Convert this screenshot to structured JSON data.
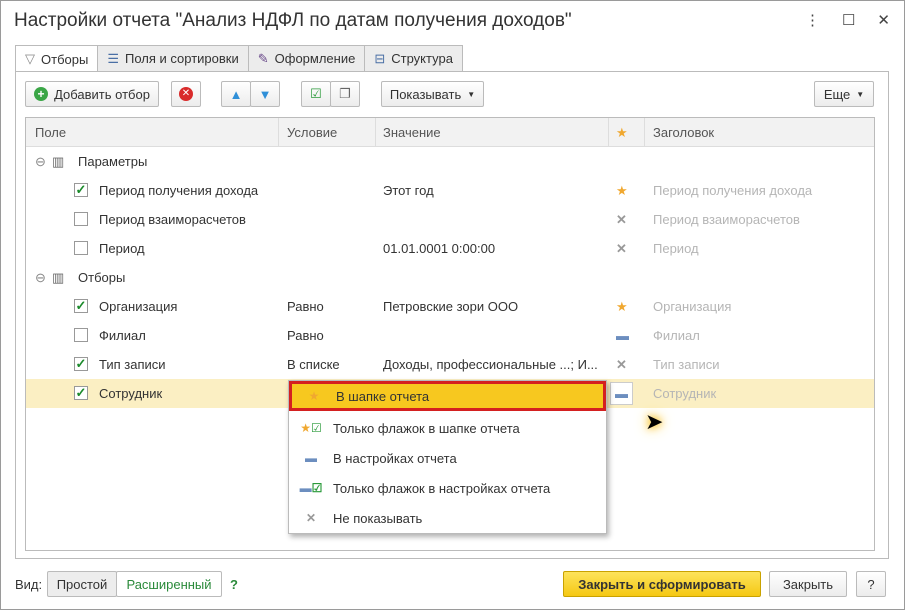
{
  "title": "Настройки отчета \"Анализ НДФЛ по датам получения доходов\"",
  "window_buttons": [
    "⋮",
    "☐",
    "✕"
  ],
  "tabs": [
    {
      "label": "Отборы",
      "icon": "filter-icon"
    },
    {
      "label": "Поля и сортировки",
      "icon": "fields-icon"
    },
    {
      "label": "Оформление",
      "icon": "brush-icon"
    },
    {
      "label": "Структура",
      "icon": "structure-icon"
    }
  ],
  "toolbar": {
    "add": "Добавить отбор",
    "show": "Показывать",
    "more": "Еще"
  },
  "columns": {
    "field": "Поле",
    "condition": "Условие",
    "value": "Значение",
    "title": "Заголовок"
  },
  "groups": {
    "params": "Параметры",
    "filters": "Отборы"
  },
  "rows": [
    {
      "field": "Период получения дохода",
      "checked": true,
      "condition": "",
      "value": "Этот год",
      "mode": "star",
      "title": "Период получения дохода"
    },
    {
      "field": "Период взаиморасчетов",
      "checked": false,
      "condition": "",
      "value": "",
      "mode": "x",
      "title": "Период взаиморасчетов"
    },
    {
      "field": "Период",
      "checked": false,
      "condition": "",
      "value": "01.01.0001 0:00:00",
      "mode": "x",
      "title": "Период"
    },
    {
      "field": "Организация",
      "checked": true,
      "condition": "Равно",
      "value": "Петровские зори ООО",
      "mode": "star",
      "title": "Организация"
    },
    {
      "field": "Филиал",
      "checked": false,
      "condition": "Равно",
      "value": "",
      "mode": "dash",
      "title": "Филиал"
    },
    {
      "field": "Тип записи",
      "checked": true,
      "condition": "В списке",
      "value": "Доходы, профессиональные ...; И...",
      "mode": "x",
      "title": "Тип записи"
    },
    {
      "field": "Сотрудник",
      "checked": true,
      "condition": "",
      "value": "",
      "mode": "dash",
      "title": "Сотрудник"
    }
  ],
  "menu": [
    "В шапке отчета",
    "Только флажок в шапке отчета",
    "В настройках отчета",
    "Только флажок в настройках отчета",
    "Не показывать"
  ],
  "bottom": {
    "view_label": "Вид:",
    "simple": "Простой",
    "advanced": "Расширенный",
    "help": "?",
    "generate": "Закрыть и сформировать",
    "close": "Закрыть",
    "help2": "?"
  }
}
